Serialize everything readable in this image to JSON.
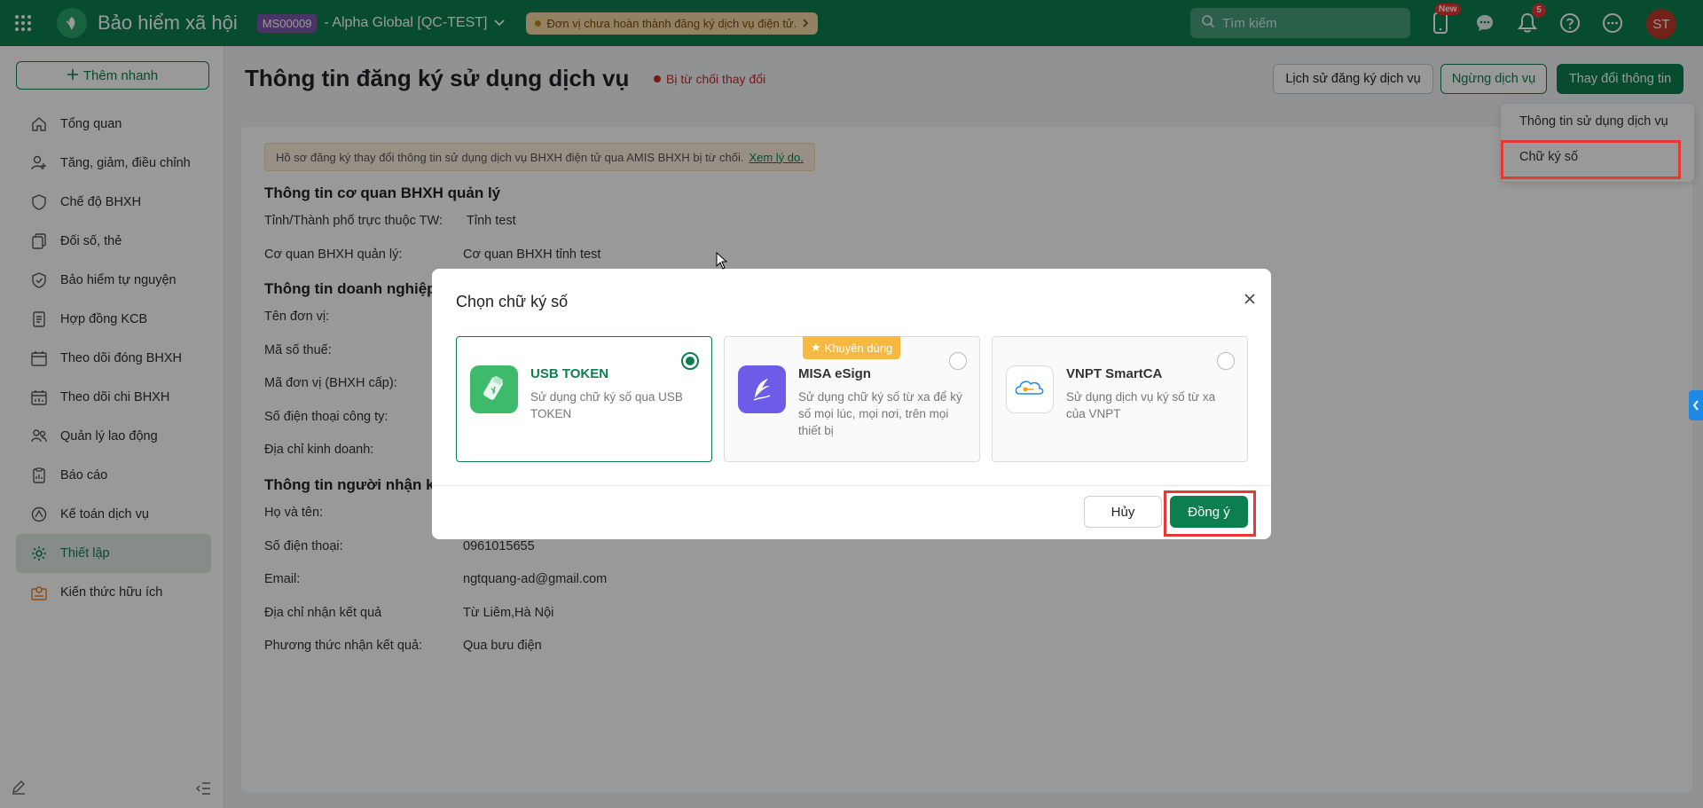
{
  "topbar": {
    "app_title": "Bảo hiểm xã hội",
    "org_code": "MS00009",
    "org_name": "- Alpha Global [QC-TEST]",
    "warning": "Đơn vị chưa hoàn thành đăng ký dịch vụ điện tử.",
    "search_placeholder": "Tìm kiếm",
    "new_badge": "New",
    "notification_count": "5",
    "avatar_initials": "ST"
  },
  "sidebar": {
    "quick_add": "Thêm nhanh",
    "items": [
      {
        "label": "Tổng quan",
        "icon": "home-icon"
      },
      {
        "label": "Tăng, giảm, điều chỉnh",
        "icon": "user-adjust-icon"
      },
      {
        "label": "Chế độ BHXH",
        "icon": "shield-heart-icon"
      },
      {
        "label": "Đối số, thẻ",
        "icon": "cards-icon"
      },
      {
        "label": "Bảo hiểm tự nguyện",
        "icon": "shield-icon"
      },
      {
        "label": "Hợp đồng KCB",
        "icon": "contract-icon"
      },
      {
        "label": "Theo dõi đóng BHXH",
        "icon": "calendar-icon"
      },
      {
        "label": "Theo dõi chi BHXH",
        "icon": "calendar-chart-icon"
      },
      {
        "label": "Quản lý lao động",
        "icon": "users-icon"
      },
      {
        "label": "Báo cáo",
        "icon": "report-icon"
      },
      {
        "label": "Kế toán dịch vụ",
        "icon": "accounting-icon"
      },
      {
        "label": "Thiết lập",
        "icon": "gear-icon",
        "active": true
      },
      {
        "label": "Kiến thức hữu ích",
        "icon": "knowledge-icon"
      }
    ]
  },
  "header": {
    "title": "Thông tin đăng ký sử dụng dịch vụ",
    "status": "Bị từ chối thay đổi",
    "history_btn": "Lịch sử đăng ký dịch vụ",
    "stop_btn": "Ngừng dịch vụ",
    "change_btn": "Thay đổi thông tin"
  },
  "side_menu": {
    "item1": "Thông tin sử dụng dịch vụ",
    "item2": "Chữ ký số"
  },
  "content": {
    "alert_text": "Hồ sơ đăng ký thay đổi thông tin sử dụng dịch vụ BHXH điện tử qua AMIS BHXH bị từ chối.",
    "alert_link": "Xem lý do.",
    "sec1_title": "Thông tin cơ quan BHXH quản lý",
    "province_label": "Tỉnh/Thành phố trực thuộc TW:",
    "province_value": "Tỉnh test",
    "agency_label": "Cơ quan BHXH quản lý:",
    "agency_value": "Cơ quan BHXH tỉnh test",
    "sec2_title": "Thông tin doanh nghiệp",
    "unit_name_label": "Tên đơn vị:",
    "tax_code_label": "Mã số thuế:",
    "unit_code_label": "Mã đơn vị (BHXH cấp):",
    "company_phone_label": "Số điện thoại công ty:",
    "business_address_label": "Địa chỉ kinh doanh:",
    "sec3_title": "Thông tin người nhận kết quả",
    "fullname_label": "Họ và tên:",
    "phone_label": "Số điện thoại:",
    "phone_value": "0961015655",
    "email_label": "Email:",
    "email_value": "ngtquang-ad@gmail.com",
    "result_address_label": "Địa chỉ nhận kết quả",
    "result_address_value": "Từ Liêm,Hà Nội",
    "method_label": "Phương thức nhận kết quả:",
    "method_value": "Qua bưu điện"
  },
  "modal": {
    "title": "Chọn chữ ký số",
    "recommended": "Khuyên dùng",
    "options": [
      {
        "name": "USB TOKEN",
        "desc": "Sử dụng chữ ký số qua USB TOKEN",
        "selected": true
      },
      {
        "name": "MISA eSign",
        "desc": "Sử dụng chữ ký số từ xa để ký số mọi lúc, mọi nơi, trên mọi thiết bị",
        "selected": false
      },
      {
        "name": "VNPT SmartCA",
        "desc": "Sử dụng dịch vụ ký số từ xa của VNPT",
        "selected": false
      }
    ],
    "cancel": "Hủy",
    "confirm": "Đồng ý"
  },
  "colors": {
    "brand_green": "#0d7f4f",
    "highlight_red": "#e53935",
    "status_red": "#c62828"
  }
}
